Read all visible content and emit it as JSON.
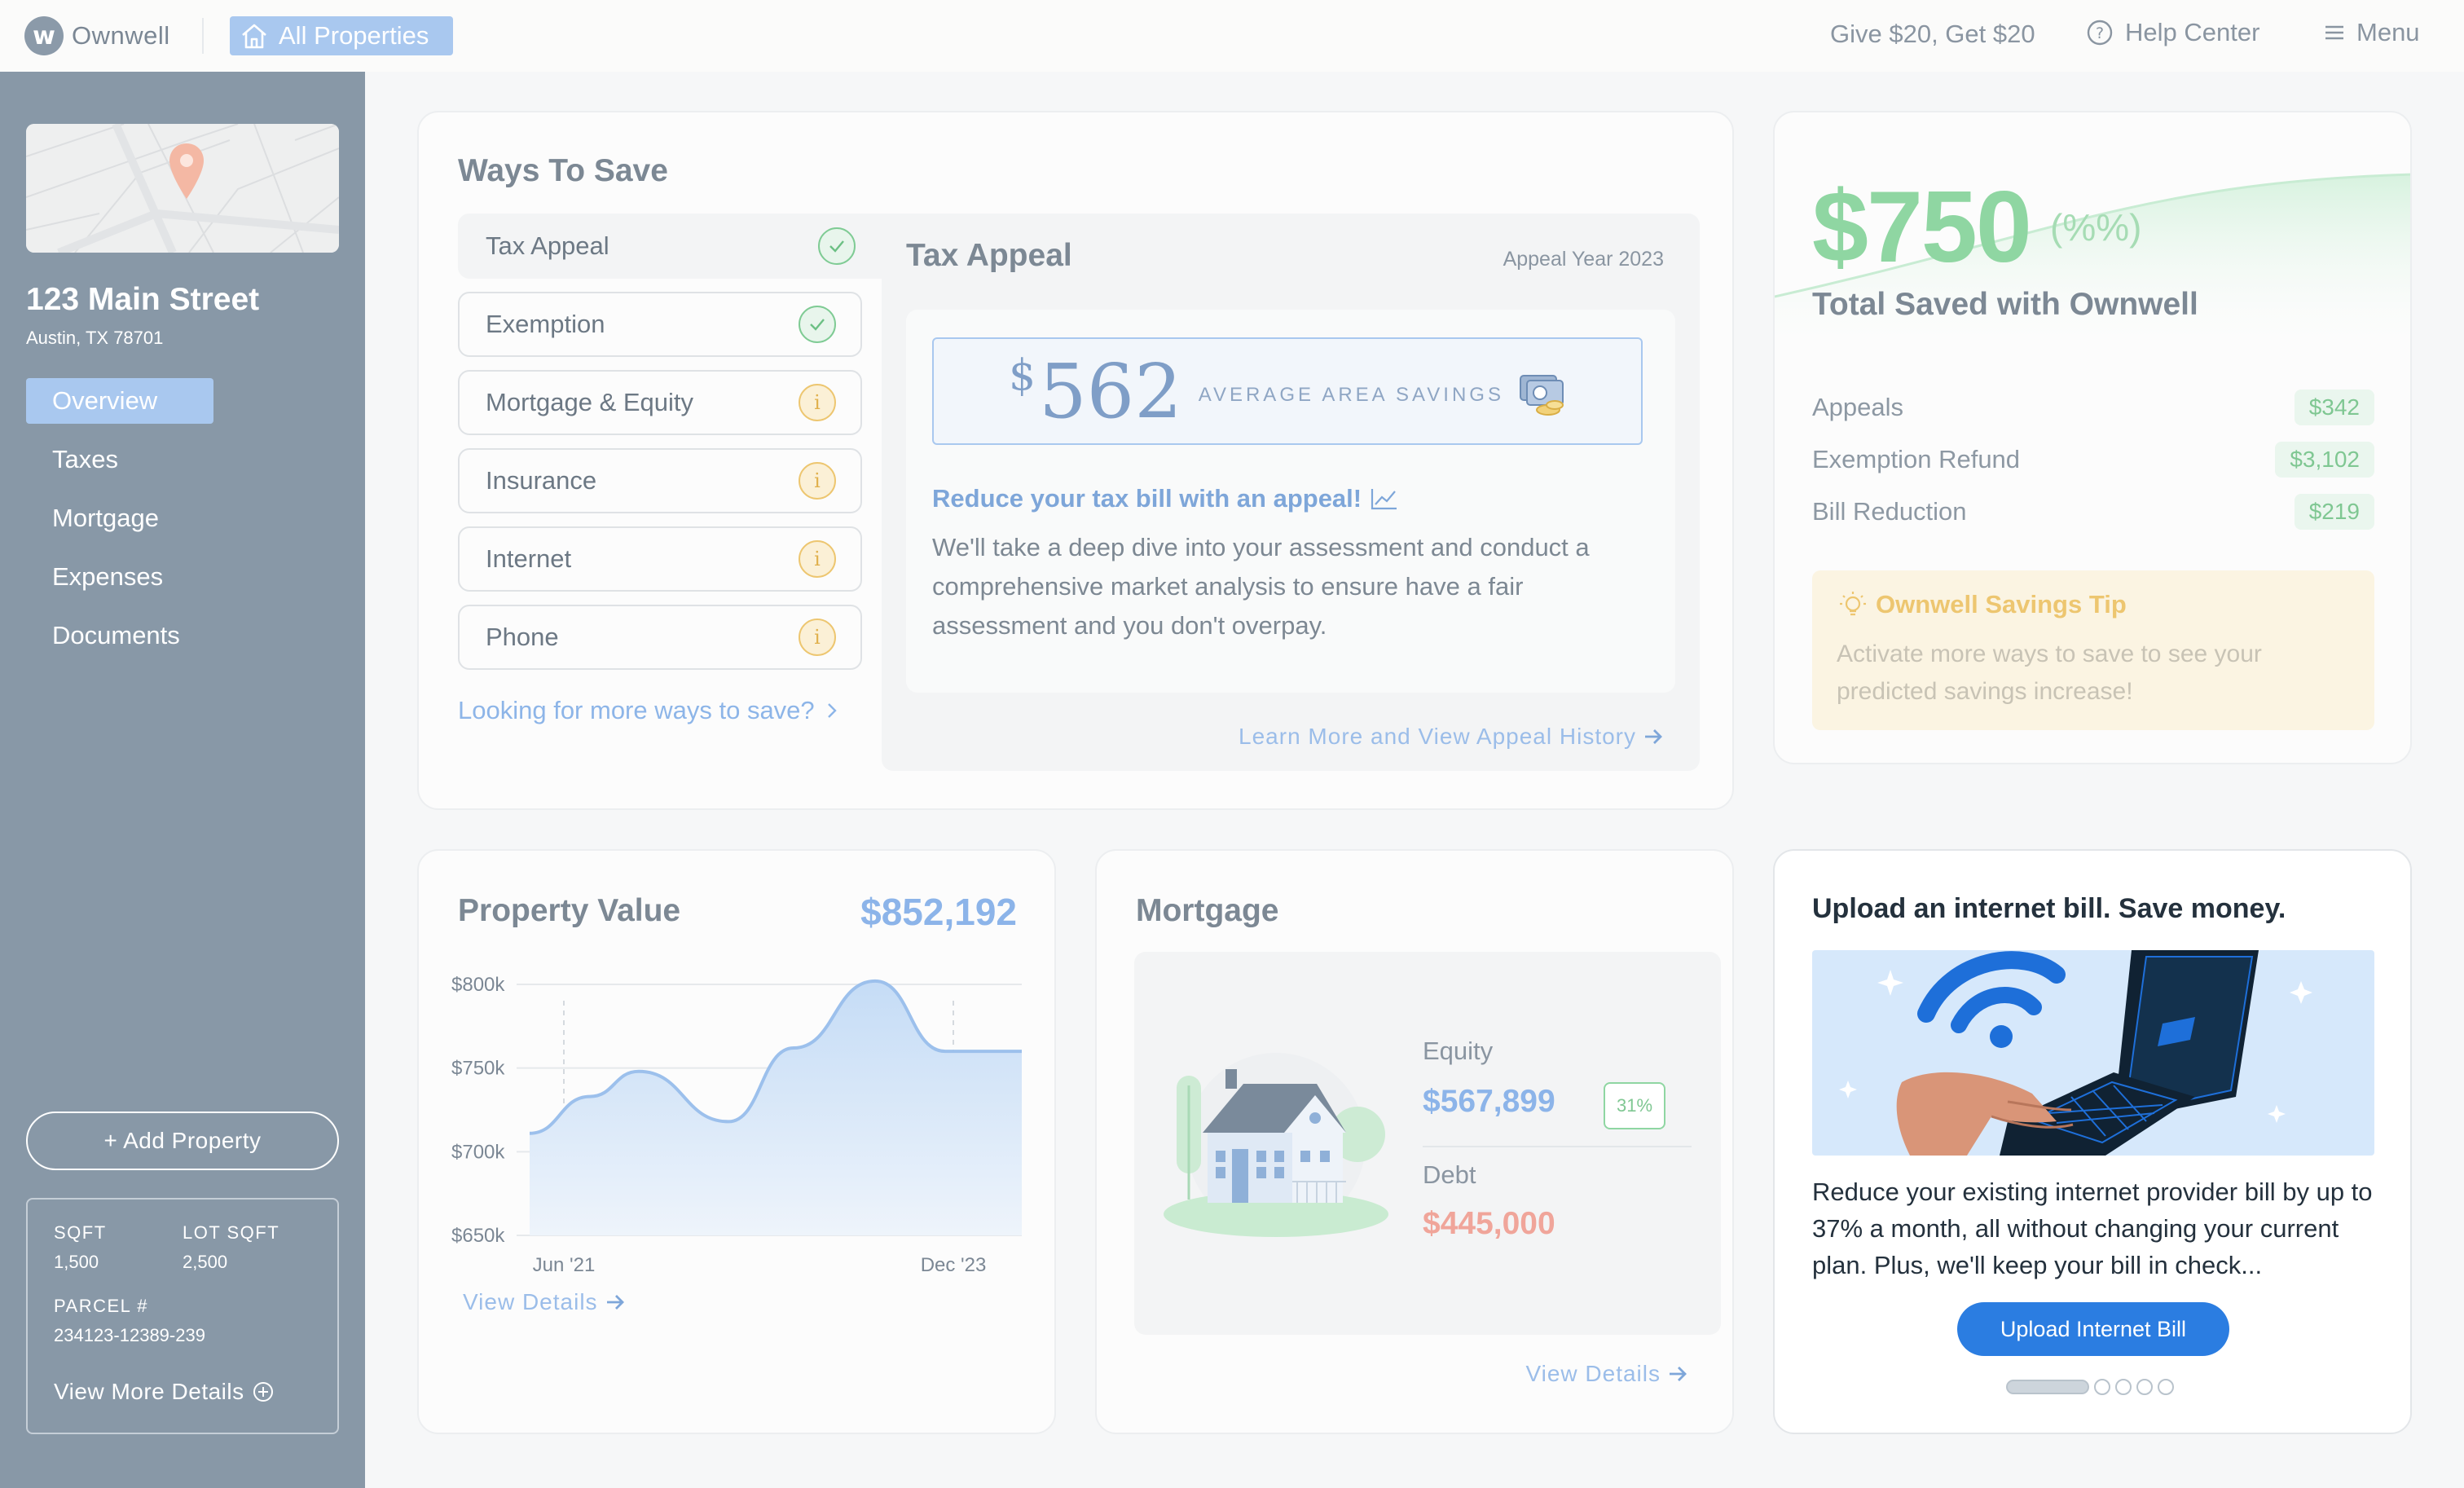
{
  "topbar": {
    "logo_text": "Ownwell",
    "all_properties": "All Properties",
    "referral": "Give $20, Get $20",
    "help_center": "Help Center",
    "menu": "Menu"
  },
  "sidebar": {
    "address": "123 Main Street",
    "city": "Austin, TX 78701",
    "nav": [
      {
        "label": "Overview",
        "active": true
      },
      {
        "label": "Taxes"
      },
      {
        "label": "Mortgage"
      },
      {
        "label": "Expenses"
      },
      {
        "label": "Documents"
      }
    ],
    "add_property": "+ Add Property",
    "details": {
      "sqft_label": "SQFT",
      "sqft": "1,500",
      "lot_label": "LOT SQFT",
      "lot": "2,500",
      "parcel_label": "PARCEL #",
      "parcel": "234123-12389-239",
      "view_more": "View More Details"
    }
  },
  "ways_to_save": {
    "title": "Ways To Save",
    "items": [
      {
        "label": "Tax Appeal",
        "status": "check-icon"
      },
      {
        "label": "Exemption",
        "status": "check-icon"
      },
      {
        "label": "Mortgage & Equity",
        "status": "info-icon"
      },
      {
        "label": "Insurance",
        "status": "info-icon"
      },
      {
        "label": "Internet",
        "status": "info-icon"
      },
      {
        "label": "Phone",
        "status": "info-icon"
      }
    ],
    "more": "Looking for more ways to save?",
    "panel": {
      "title": "Tax Appeal",
      "year": "Appeal Year 2023",
      "avg_dollar": "$",
      "avg_value": "562",
      "avg_label": "AVERAGE AREA SAVINGS",
      "subhead": "Reduce your tax bill with an appeal!",
      "body": "We'll take a deep dive into your assessment and conduct a comprehensive market analysis to ensure have a fair assessment and you don't overpay.",
      "link": "Learn More and View Appeal History"
    }
  },
  "total_saved": {
    "amount": "$750",
    "pct": "(%%)",
    "label": "Total Saved with Ownwell",
    "rows": [
      {
        "label": "Appeals",
        "value": "$342"
      },
      {
        "label": "Exemption Refund",
        "value": "$3,102"
      },
      {
        "label": "Bill Reduction",
        "value": "$219"
      }
    ],
    "tip_title": "Ownwell Savings Tip",
    "tip_body": "Activate more ways to save to see your predicted savings increase!"
  },
  "property_value": {
    "title": "Property Value",
    "value": "$852,192",
    "link": "View Details"
  },
  "chart_data": {
    "type": "area",
    "title": "Property Value",
    "y_ticks": [
      "$800k",
      "$750k",
      "$700k",
      "$650k"
    ],
    "x_ticks": [
      "Jun '21",
      "Dec '23"
    ],
    "ylim": [
      650000,
      800000
    ],
    "values": [
      711000,
      733000,
      748000,
      718000,
      762000,
      802000,
      760000,
      760000
    ]
  },
  "mortgage": {
    "title": "Mortgage",
    "equity_label": "Equity",
    "equity_value": "$567,899",
    "equity_pct": "31%",
    "debt_label": "Debt",
    "debt_value": "$445,000",
    "link": "View Details"
  },
  "upload": {
    "title": "Upload an internet bill. Save money.",
    "body": "Reduce your existing internet provider bill by up to 37% a month, all without changing your current plan. Plus, we'll keep your bill in check...",
    "button": "Upload Internet Bill"
  },
  "colors": {
    "sidebar": "#8898a7",
    "accent_blue": "#a9c8ef",
    "green": "#8fd6a2",
    "primary_button": "#2b7de1"
  }
}
